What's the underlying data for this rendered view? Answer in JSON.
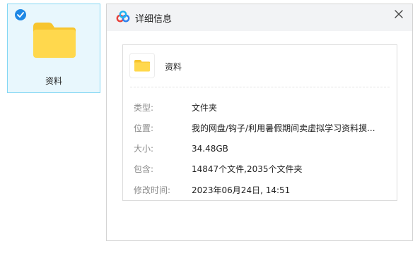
{
  "folder_tile": {
    "label": "资料",
    "selected": true
  },
  "dialog": {
    "title": "详细信息",
    "close_symbol": "×",
    "item_name": "资料",
    "details": [
      {
        "label": "类型:",
        "value": "文件夹"
      },
      {
        "label": "位置:",
        "value": "我的网盘/钩子/利用暑假期间卖虚拟学习资料摸..."
      },
      {
        "label": "大小:",
        "value": "34.48GB"
      },
      {
        "label": "包含:",
        "value": "14847个文件,2035个文件夹"
      },
      {
        "label": "修改时间:",
        "value": "2023年06月24日, 14:51"
      }
    ]
  },
  "colors": {
    "selection_bg": "#e8f7fd",
    "selection_border": "#84d7f4",
    "check_badge": "#1e88e5",
    "folder_yellow": "#ffd84d",
    "folder_tab": "#f7c52e"
  },
  "icons": [
    "check-badge-icon",
    "folder-icon",
    "app-logo-icon",
    "close-icon"
  ]
}
